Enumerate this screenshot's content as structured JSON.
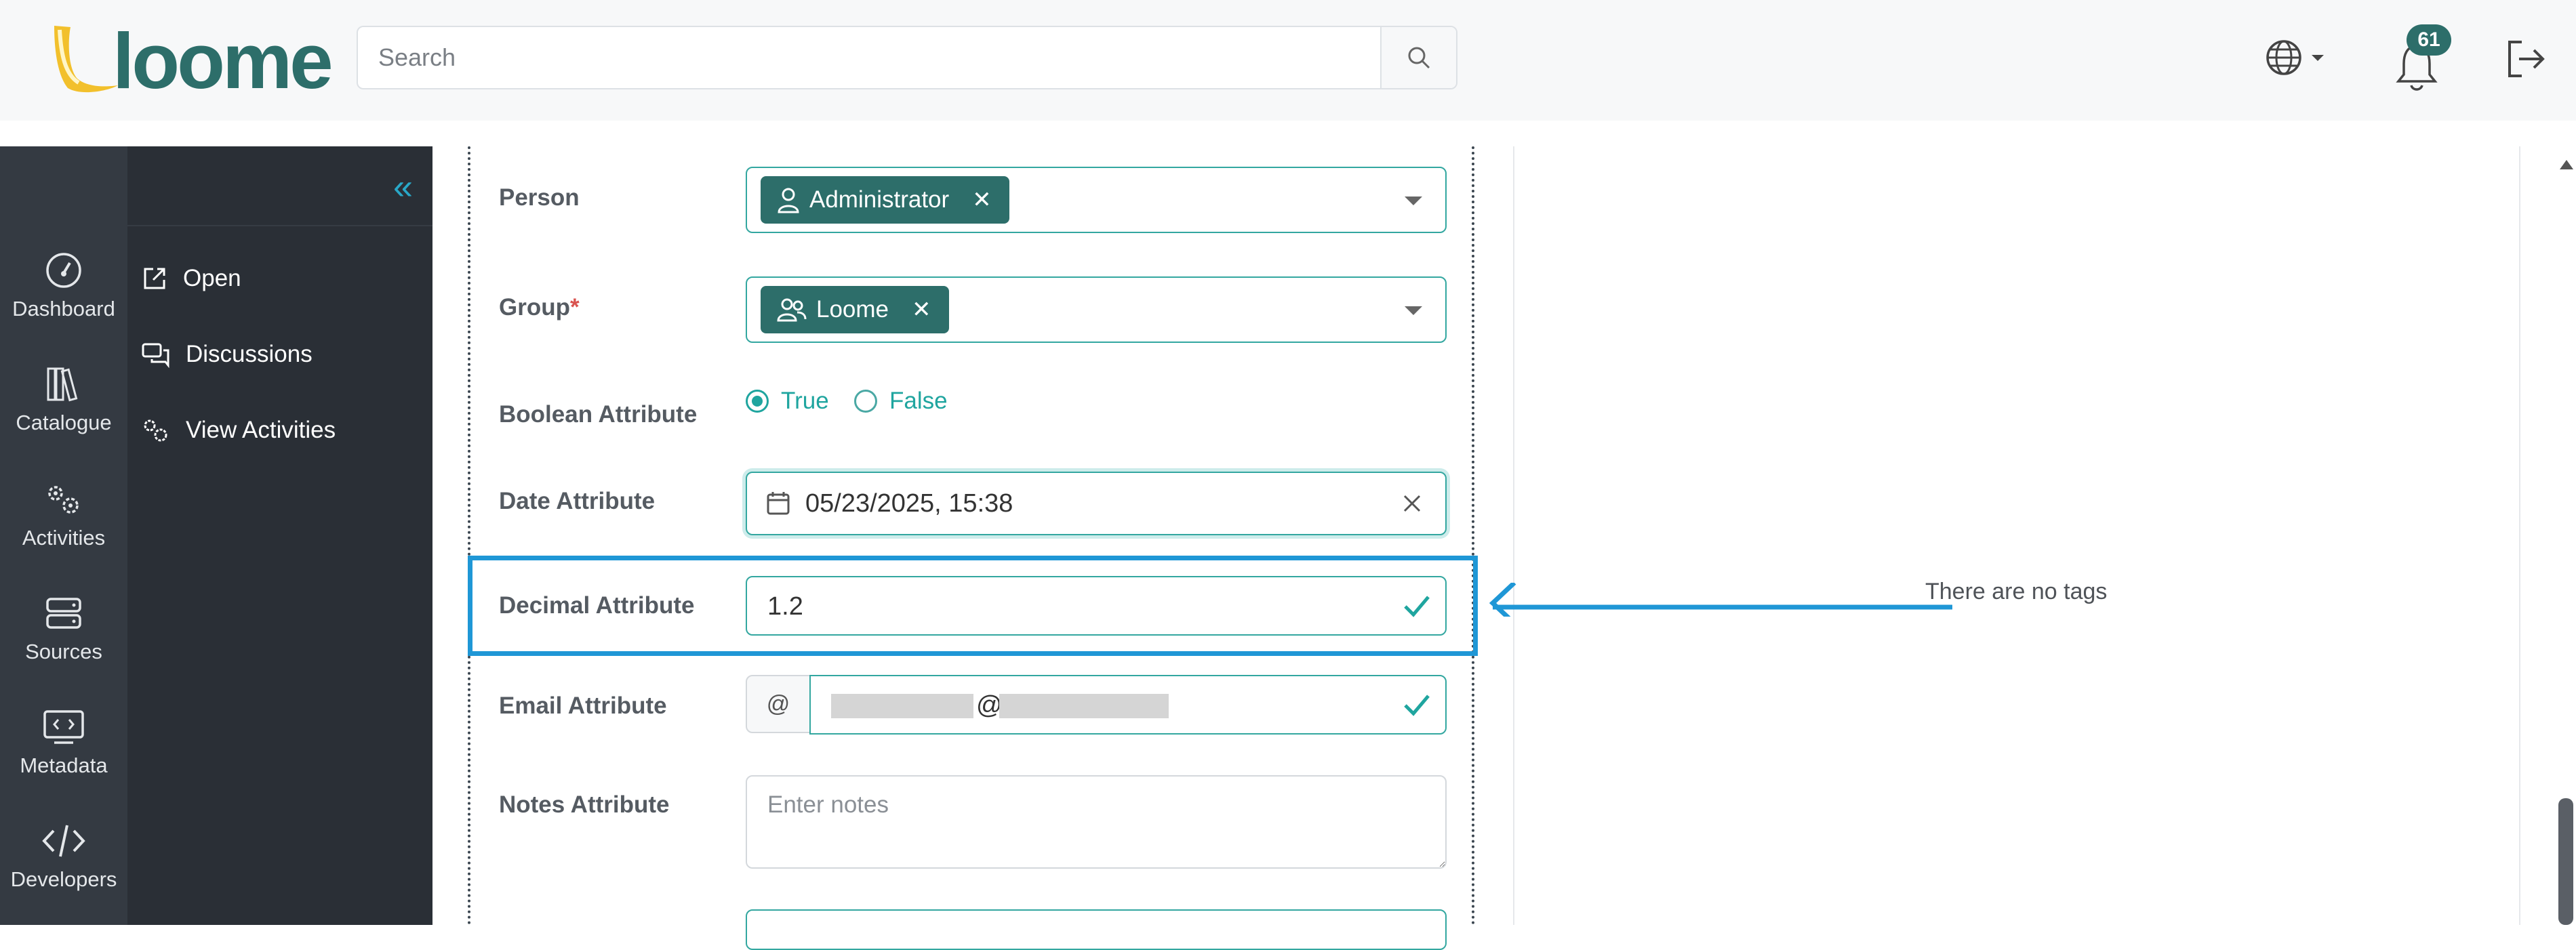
{
  "app": {
    "logo_text": "Loome"
  },
  "header": {
    "search_placeholder": "Search",
    "notification_count": "61"
  },
  "rail": {
    "items": [
      {
        "label": "Dashboard",
        "icon": "dashboard-icon"
      },
      {
        "label": "Catalogue",
        "icon": "catalogue-icon"
      },
      {
        "label": "Activities",
        "icon": "activities-icon"
      },
      {
        "label": "Sources",
        "icon": "sources-icon"
      },
      {
        "label": "Metadata",
        "icon": "metadata-icon"
      },
      {
        "label": "Developers",
        "icon": "developers-icon"
      }
    ]
  },
  "subnav": {
    "collapse_glyph": "«",
    "items": [
      {
        "label": "Open",
        "icon": "external-link-icon"
      },
      {
        "label": "Discussions",
        "icon": "chat-icon"
      },
      {
        "label": "View Activities",
        "icon": "cogs-icon"
      }
    ]
  },
  "form": {
    "person": {
      "label": "Person",
      "tag": "Administrator"
    },
    "group": {
      "label": "Group",
      "required_mark": "*",
      "tag": "Loome"
    },
    "boolean": {
      "label": "Boolean Attribute",
      "options": [
        "True",
        "False"
      ],
      "selected": "True"
    },
    "date": {
      "label": "Date Attribute",
      "value": "05/23/2025, 15:38"
    },
    "decimal": {
      "label": "Decimal Attribute",
      "value": "1.2"
    },
    "email": {
      "label": "Email Attribute",
      "prefix": "@",
      "at": "@"
    },
    "notes": {
      "label": "Notes Attribute",
      "placeholder": "Enter notes"
    }
  },
  "tags_panel": {
    "empty_text": "There are no tags"
  },
  "colors": {
    "accent": "#33a7a0",
    "tag_bg": "#2d6e6a",
    "highlight": "#1f97d6",
    "sidebar_bg": "#343a42"
  }
}
